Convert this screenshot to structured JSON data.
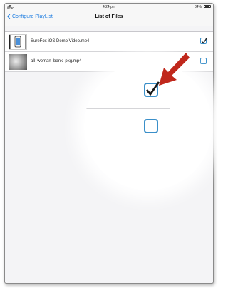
{
  "status_bar": {
    "device": "iPad",
    "wifi_icon": "wifi-icon",
    "time": "4:24 pm",
    "battery": "84%",
    "battery_icon": "battery-icon"
  },
  "nav": {
    "back_label": "Configure PlayList",
    "back_icon": "chevron-left-icon",
    "title": "List of Files"
  },
  "files": [
    {
      "name": "SureFox iOS Demo Video.mp4",
      "checked": true
    },
    {
      "name": "all_woman_bank_pkg.mp4",
      "checked": false
    }
  ],
  "colors": {
    "accent": "#1a7ae0",
    "checkbox": "#3a8fc9",
    "arrow": "#c0281c"
  },
  "annotation": {
    "arrow_icon": "red-arrow-icon",
    "magnified_checkboxes": [
      true,
      false
    ]
  }
}
